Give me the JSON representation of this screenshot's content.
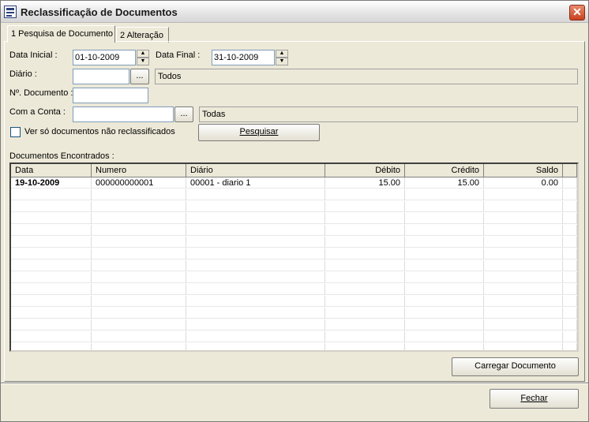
{
  "window": {
    "title": "Reclassificação de Documentos",
    "close_label": "✕"
  },
  "tabs": [
    {
      "label": "1 Pesquisa de Documento"
    },
    {
      "label": "2 Alteração"
    }
  ],
  "form": {
    "data_inicial_label": "Data Inicial :",
    "data_inicial_value": "01-10-2009",
    "data_final_label": "Data Final :",
    "data_final_value": "31-10-2009",
    "diario_label": "Diário :",
    "diario_value": "",
    "diario_desc": "Todos",
    "ndoc_label": "Nº. Documento :",
    "ndoc_value": "",
    "conta_label": "Com a Conta :",
    "conta_value": "",
    "conta_desc": "Todas",
    "checkbox_label": "Ver só documentos não reclassificados",
    "checkbox_checked": false,
    "ellipsis_label": "...",
    "pesquisar_label": "Pesquisar"
  },
  "results": {
    "label": "Documentos Encontrados :",
    "columns": [
      "Data",
      "Numero",
      "Diário",
      "Débito",
      "Crédito",
      "Saldo"
    ],
    "rows": [
      [
        "19-10-2009",
        "000000000001",
        "00001 - diario 1",
        "15.00",
        "15.00",
        "0.00"
      ]
    ]
  },
  "buttons": {
    "carregar": "Carregar Documento",
    "fechar": "Fechar"
  },
  "icons": {
    "app": "document-window-icon",
    "close": "close-icon",
    "spin_up": "spin-up-icon",
    "spin_down": "spin-down-icon"
  }
}
